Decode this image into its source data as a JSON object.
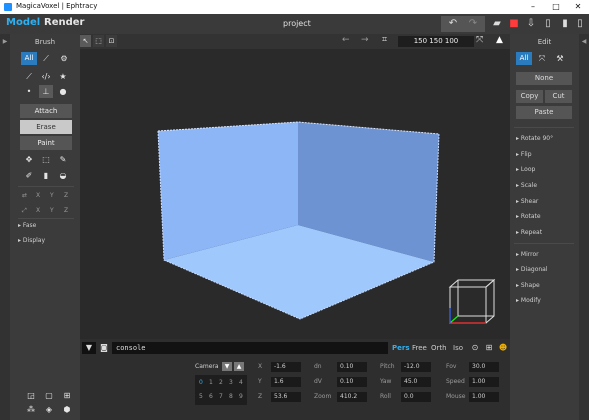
{
  "window": {
    "title": "MagicaVoxel | Ephtracy"
  },
  "menubar": {
    "modes": [
      "Model",
      "Render"
    ],
    "project_name": "project"
  },
  "brush_panel": {
    "title": "Brush",
    "filter_label": "All",
    "actions": [
      "Attach",
      "Erase",
      "Paint"
    ],
    "axis_rows": [
      [
        "X",
        "Y",
        "Z"
      ],
      [
        "X",
        "Y",
        "Z"
      ]
    ],
    "sections": [
      "Fase",
      "Display"
    ]
  },
  "edit_panel": {
    "title": "Edit",
    "filter_label": "All",
    "buttons": {
      "none": "None",
      "copy": "Copy",
      "cut": "Cut",
      "paste": "Paste"
    },
    "group1": [
      "Rotate 90°",
      "Flip",
      "Loop",
      "Scale",
      "Shear",
      "Rotate",
      "Repeat"
    ],
    "group2": [
      "Mirror",
      "Diagonal",
      "Shape",
      "Modify"
    ]
  },
  "viewport_toolbar": {
    "size": "150  150  100"
  },
  "console": {
    "text": "console"
  },
  "camera_modes": [
    "Pers",
    "Free",
    "Orth",
    "Iso"
  ],
  "camera_panel": {
    "label": "Camera",
    "slots": [
      "0",
      "1",
      "2",
      "3",
      "4",
      "5",
      "6",
      "7",
      "8",
      "9"
    ],
    "fields": {
      "x_label": "X",
      "x": "-1.6",
      "y_label": "Y",
      "y": "1.6",
      "z_label": "Z",
      "z": "53.6",
      "dn_label": "dn",
      "dn": "0.10",
      "dv_label": "dV",
      "dv": "0.10",
      "zoom_label": "Zoom",
      "zoom": "410.2",
      "pitch_label": "Pitch",
      "pitch": "-12.0",
      "yaw_label": "Yaw",
      "yaw": "45.0",
      "roll_label": "Roll",
      "roll": "0.0",
      "fov_label": "Fov",
      "fov": "30.0",
      "speed_label": "Speed",
      "speed": "1.00",
      "mouse_label": "Mouse",
      "mouse": "1.00"
    }
  },
  "colors": {
    "accent": "#2fb0f0",
    "voxel_face": "#8fb8f5",
    "selected_brush": "#2b7bbf"
  }
}
